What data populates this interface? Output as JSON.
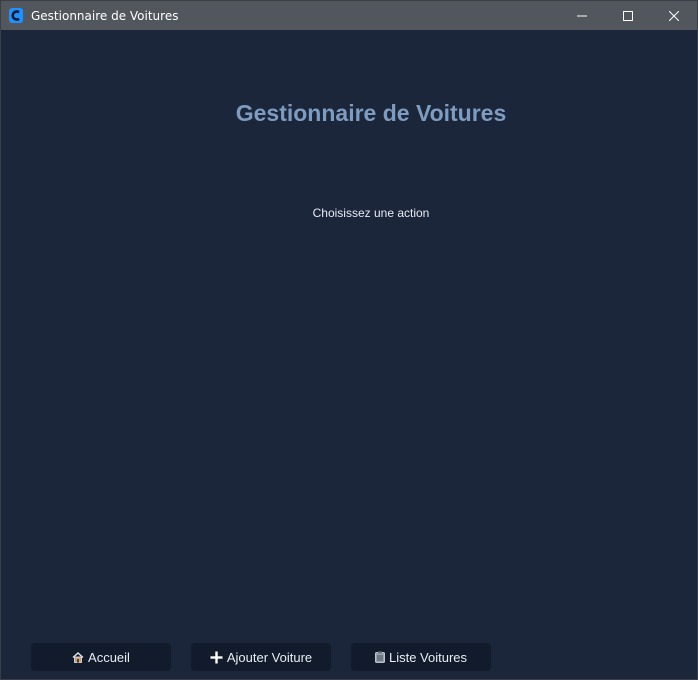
{
  "window": {
    "title": "Gestionnaire de Voitures",
    "icon": "app-icon"
  },
  "main": {
    "heading": "Gestionnaire de Voitures",
    "subtitle": "Choisissez une action"
  },
  "nav": {
    "buttons": [
      {
        "label": "Accueil",
        "icon": "home-icon"
      },
      {
        "label": "Ajouter Voiture",
        "icon": "plus-icon"
      },
      {
        "label": "Liste Voitures",
        "icon": "clipboard-icon"
      }
    ]
  },
  "colors": {
    "background": "#1c263a",
    "heading": "#7d9cc0",
    "button_bg": "#111b2b",
    "titlebar": "#52575e",
    "app_icon": "#1e90ff"
  }
}
